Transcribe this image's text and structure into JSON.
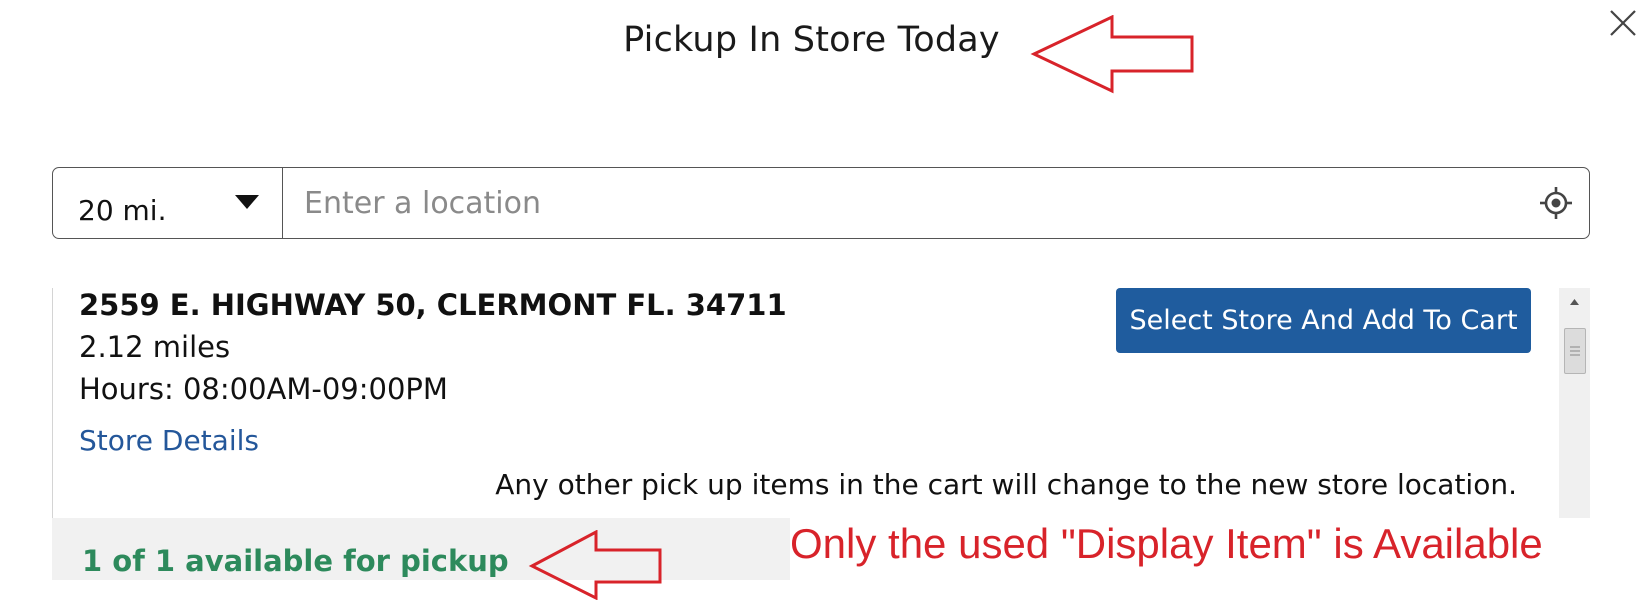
{
  "dialog": {
    "title": "Pickup In Store Today",
    "close_icon": "close-icon"
  },
  "search": {
    "distance_value": "20 mi.",
    "location_placeholder": "Enter a location",
    "dropdown_icon": "caret-down-icon",
    "locate_icon": "crosshair-locate-icon"
  },
  "store": {
    "address": "2559 E. HIGHWAY 50, CLERMONT FL. 34711",
    "distance": "2.12 miles",
    "hours": "Hours: 08:00AM-09:00PM",
    "details_link": "Store Details",
    "select_button_label": "Select Store And Add To Cart",
    "notice": "Any other pick up items in the cart will change to the new store location.",
    "availability": "1 of 1 available for pickup"
  },
  "annotations": {
    "note": "Only the used \"Display Item\" is Available",
    "arrow_icon": "left-arrow-icon",
    "color": "#d8232a"
  },
  "colors": {
    "primary_button": "#1f5c9e",
    "link": "#24579a",
    "availability": "#2d8a5c"
  }
}
